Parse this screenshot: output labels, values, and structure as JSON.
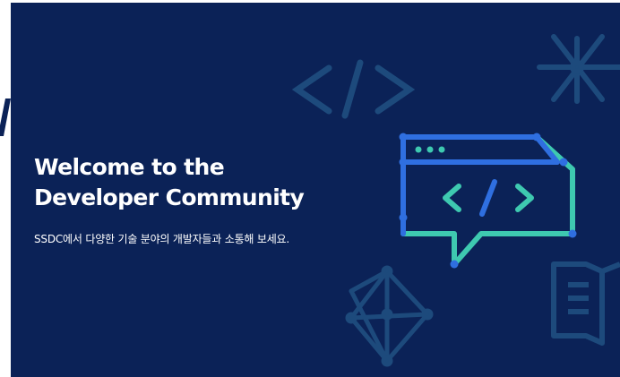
{
  "banner": {
    "headline_line1": "Welcome to the",
    "headline_line2": "Developer Community",
    "subtitle": "SSDC에서 다양한 기술 분야의 개발자들과 소통해 보세요."
  },
  "colors": {
    "background": "#0b2257",
    "accent_blue": "#2f6fe0",
    "accent_green": "#3ec9b0",
    "muted_icon": "#1f4a7a"
  },
  "icons": [
    "code-brackets-icon",
    "code-chat-bubble-icon",
    "asterisk-network-icon",
    "polyhedron-network-icon",
    "book-icon"
  ]
}
